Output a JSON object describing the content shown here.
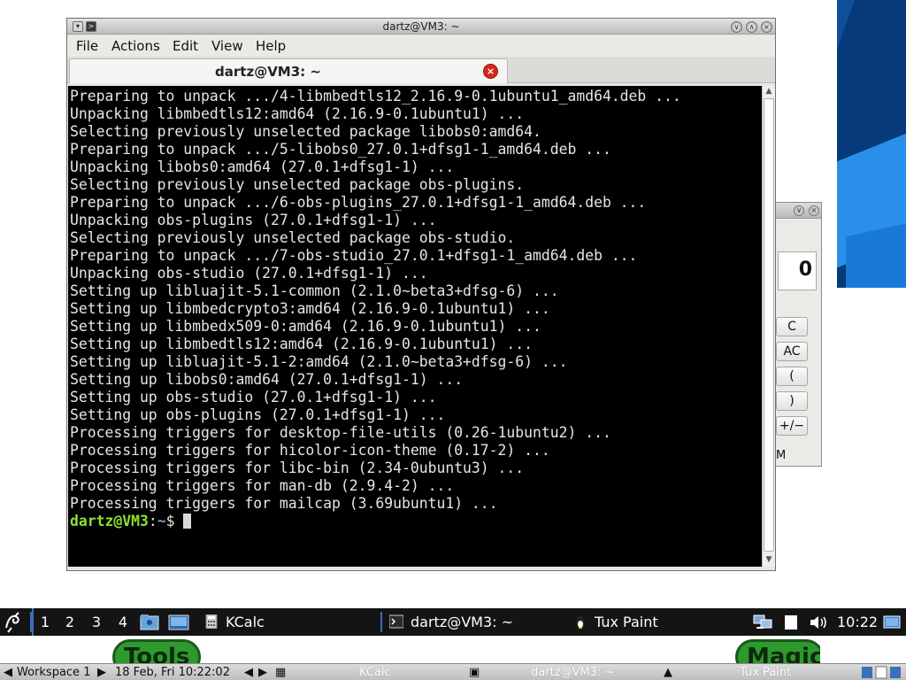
{
  "terminal": {
    "window_title": "dartz@VM3: ~",
    "menu": [
      "File",
      "Actions",
      "Edit",
      "View",
      "Help"
    ],
    "tab_title": "dartz@VM3: ~",
    "lines": [
      "Preparing to unpack .../4-libmbedtls12_2.16.9-0.1ubuntu1_amd64.deb ...",
      "Unpacking libmbedtls12:amd64 (2.16.9-0.1ubuntu1) ...",
      "Selecting previously unselected package libobs0:amd64.",
      "Preparing to unpack .../5-libobs0_27.0.1+dfsg1-1_amd64.deb ...",
      "Unpacking libobs0:amd64 (27.0.1+dfsg1-1) ...",
      "Selecting previously unselected package obs-plugins.",
      "Preparing to unpack .../6-obs-plugins_27.0.1+dfsg1-1_amd64.deb ...",
      "Unpacking obs-plugins (27.0.1+dfsg1-1) ...",
      "Selecting previously unselected package obs-studio.",
      "Preparing to unpack .../7-obs-studio_27.0.1+dfsg1-1_amd64.deb ...",
      "Unpacking obs-studio (27.0.1+dfsg1-1) ...",
      "Setting up libluajit-5.1-common (2.1.0~beta3+dfsg-6) ...",
      "Setting up libmbedcrypto3:amd64 (2.16.9-0.1ubuntu1) ...",
      "Setting up libmbedx509-0:amd64 (2.16.9-0.1ubuntu1) ...",
      "Setting up libmbedtls12:amd64 (2.16.9-0.1ubuntu1) ...",
      "Setting up libluajit-5.1-2:amd64 (2.1.0~beta3+dfsg-6) ...",
      "Setting up libobs0:amd64 (27.0.1+dfsg1-1) ...",
      "Setting up obs-studio (27.0.1+dfsg1-1) ...",
      "Setting up obs-plugins (27.0.1+dfsg1-1) ...",
      "Processing triggers for desktop-file-utils (0.26-1ubuntu2) ...",
      "Processing triggers for hicolor-icon-theme (0.17-2) ...",
      "Processing triggers for libc-bin (2.34-0ubuntu3) ...",
      "Processing triggers for man-db (2.9.4-2) ...",
      "Processing triggers for mailcap (3.69ubuntu1) ..."
    ],
    "prompt_user": "dartz@VM3",
    "prompt_sep": ":",
    "prompt_path": "~",
    "prompt_symbol": "$"
  },
  "kcalc": {
    "display": "0",
    "buttons": [
      "C",
      "AC",
      "(",
      ")",
      "+/−"
    ],
    "memory_label": "M"
  },
  "tuxpaint": {
    "tools_label": "Tools",
    "magic_label": "Magic"
  },
  "top_panel": {
    "workspaces": [
      "1",
      "2",
      "3",
      "4"
    ],
    "tasks": [
      "KCalc",
      "dartz@VM3: ~",
      "Tux Paint"
    ],
    "clock": "10:22"
  },
  "bottom_panel": {
    "workspace": "Workspace 1",
    "datetime": "18 Feb, Fri 10:22:02",
    "tasks": [
      "KCalc",
      "dartz@VM3: ~",
      "Tux Paint"
    ]
  },
  "colors": {
    "terminal_bg": "#000000",
    "terminal_fg": "#e6e6e6",
    "prompt_user": "#8ae234",
    "prompt_path": "#729fcf",
    "panel_bg": "#141414",
    "accent": "#3d6fb8"
  }
}
